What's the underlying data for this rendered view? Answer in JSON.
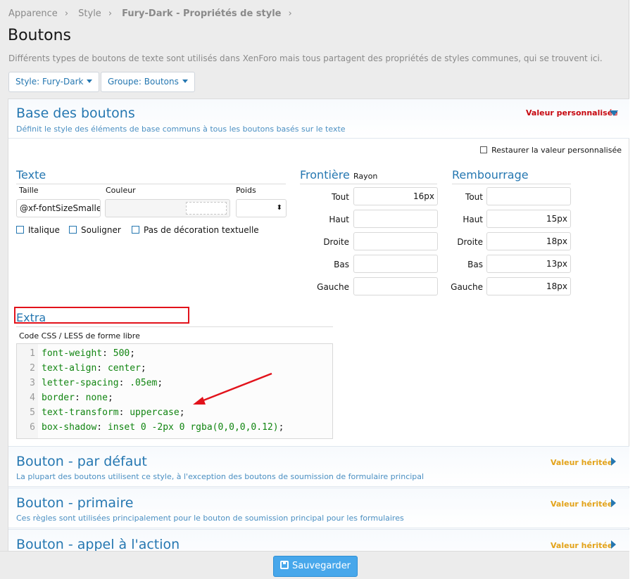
{
  "breadcrumb": [
    "Apparence",
    "Style",
    "Fury-Dark - Propriétés de style"
  ],
  "page": {
    "title": "Boutons",
    "description": "Différents types de boutons de texte sont utilisés dans XenForo mais tous partagent des propriétés de styles communes, qui se trouvent ici."
  },
  "filters": {
    "style": "Style: Fury-Dark",
    "group": "Groupe: Boutons"
  },
  "base": {
    "title": "Base des boutons",
    "subtitle": "Définit le style des éléments de base communs à tous les boutons basés sur le texte",
    "badge": "Valeur personnalisée",
    "restore_label": "Restaurer la valeur personnalisée"
  },
  "text_group": {
    "title": "Texte",
    "size_label": "Taille",
    "color_label": "Couleur",
    "weight_label": "Poids",
    "size_value": "@xf-fontSizeSmalle",
    "italic_label": "Italique",
    "underline_label": "Souligner",
    "no_decoration_label": "Pas de décoration textuelle"
  },
  "border_group": {
    "title": "Frontière",
    "radius_label": "Rayon",
    "rows": [
      {
        "label": "Tout",
        "value": "16px"
      },
      {
        "label": "Haut",
        "value": ""
      },
      {
        "label": "Droite",
        "value": ""
      },
      {
        "label": "Bas",
        "value": ""
      },
      {
        "label": "Gauche",
        "value": ""
      }
    ]
  },
  "padding_group": {
    "title": "Rembourrage",
    "rows": [
      {
        "label": "Tout",
        "value": ""
      },
      {
        "label": "Haut",
        "value": "15px"
      },
      {
        "label": "Droite",
        "value": "18px"
      },
      {
        "label": "Bas",
        "value": "13px"
      },
      {
        "label": "Gauche",
        "value": "18px"
      }
    ]
  },
  "extra": {
    "title": "Extra",
    "code_label": "Code CSS / LESS de forme libre",
    "lines": [
      {
        "n": "1",
        "prop": "font-weight",
        "value": "500"
      },
      {
        "n": "2",
        "prop": "text-align",
        "value": "center"
      },
      {
        "n": "3",
        "prop": "letter-spacing",
        "value": ".05em"
      },
      {
        "n": "4",
        "prop": "border",
        "value": "none"
      },
      {
        "n": "5",
        "prop": "text-transform",
        "value": "uppercase"
      },
      {
        "n": "6",
        "prop": "box-shadow",
        "value": "inset 0 -2px 0 rgba(0,0,0,0.12)"
      }
    ]
  },
  "sections": [
    {
      "title": "Bouton - par défaut",
      "subtitle": "La plupart des boutons utilisent ce style, à l'exception des boutons de soumission de formulaire principal",
      "badge": "Valeur héritée"
    },
    {
      "title": "Bouton - primaire",
      "subtitle": "Ces règles sont utilisées principalement pour le bouton de soumission principal pour les formulaires",
      "badge": "Valeur héritée"
    },
    {
      "title": "Bouton - appel à l'action",
      "subtitle": "",
      "badge": "Valeur héritée"
    }
  ],
  "footer": {
    "save_label": "Sauvegarder"
  },
  "colors": {
    "accent": "#2577b1",
    "custom_badge": "#c7070f",
    "inherited_badge": "#e3a31a",
    "highlight": "#e2121b",
    "save_button": "#47a7eb"
  }
}
